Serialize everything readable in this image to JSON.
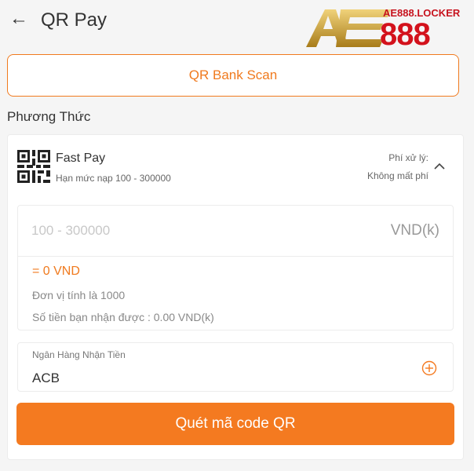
{
  "header": {
    "title": "QR Pay",
    "back_icon": "←",
    "logo_text_small": "AE888.LOCKER",
    "logo_text_big": "888",
    "brand_gold": "#c9a227",
    "brand_red": "#d3121c"
  },
  "scan_button": {
    "label": "QR Bank Scan"
  },
  "methods": {
    "section_label": "Phương Thức",
    "selected": {
      "name": "Fast Pay",
      "limit": "Hạn mức nạp 100 - 300000",
      "fee_label": "Phí xử lý:",
      "fee_value": "Không mất phí",
      "icon": "qr-code-icon",
      "expand_icon": "chevron-up-icon"
    }
  },
  "amount": {
    "placeholder": "100 - 300000",
    "value": "",
    "currency": "VND(k)",
    "converted": "= 0 VND",
    "unit_note": "Đơn vị tính là 1000",
    "receive_note": "Số tiền bạn nhận được : 0.00 VND(k)"
  },
  "bank": {
    "label": "Ngân Hàng Nhận Tiền",
    "value": "ACB",
    "add_icon": "plus-circle-icon"
  },
  "submit": {
    "label": "Quét mã code QR"
  },
  "colors": {
    "accent": "#f47a20",
    "text": "#333333",
    "muted": "#888888"
  }
}
